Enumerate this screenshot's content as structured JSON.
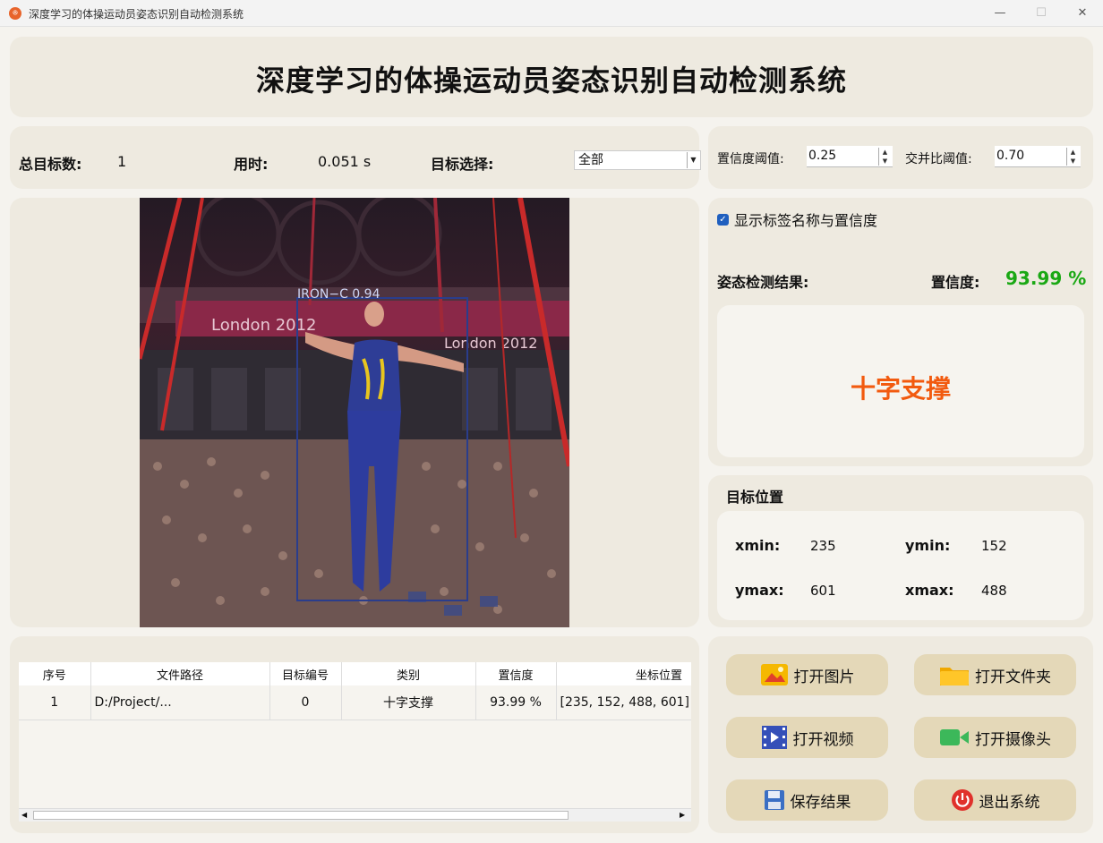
{
  "window": {
    "title": "深度学习的体操运动员姿态识别自动检测系统",
    "minimize": "—",
    "maximize": "☐",
    "close": "✕"
  },
  "header": {
    "title": "深度学习的体操运动员姿态识别自动检测系统"
  },
  "stats": {
    "total_label": "总目标数:",
    "total_value": "1",
    "time_label": "用时:",
    "time_value": "0.051 s",
    "select_label": "目标选择:",
    "select_value": "全部"
  },
  "thresholds": {
    "conf_label": "置信度阈值:",
    "conf_value": "0.25",
    "iou_label": "交并比阈值:",
    "iou_value": "0.70"
  },
  "detection_image": {
    "box_label": "IRON−C 0.94",
    "banner_left": "London 2012",
    "banner_right": "London 2012"
  },
  "result": {
    "show_label_text": "显示标签名称与置信度",
    "show_label_checked": true,
    "result_label": "姿态检测结果:",
    "conf_label": "置信度:",
    "conf_value": "93.99 %",
    "class_name": "十字支撑",
    "conf_color": "#1aa814",
    "class_color": "#f25a0f"
  },
  "position": {
    "title": "目标位置",
    "xmin_label": "xmin:",
    "xmin_value": "235",
    "ymin_label": "ymin:",
    "ymin_value": "152",
    "ymax_label": "ymax:",
    "ymax_value": "601",
    "xmax_label": "xmax:",
    "xmax_value": "488"
  },
  "table": {
    "headers": [
      "序号",
      "文件路径",
      "目标编号",
      "类别",
      "置信度",
      "坐标位置"
    ],
    "rows": [
      [
        "1",
        "D:/Project/...",
        "0",
        "十字支撑",
        "93.99 %",
        "[235, 152, 488, 601]"
      ]
    ]
  },
  "buttons": {
    "open_image": "打开图片",
    "open_folder": "打开文件夹",
    "open_video": "打开视频",
    "open_camera": "打开摄像头",
    "save_result": "保存结果",
    "exit_system": "退出系统"
  }
}
